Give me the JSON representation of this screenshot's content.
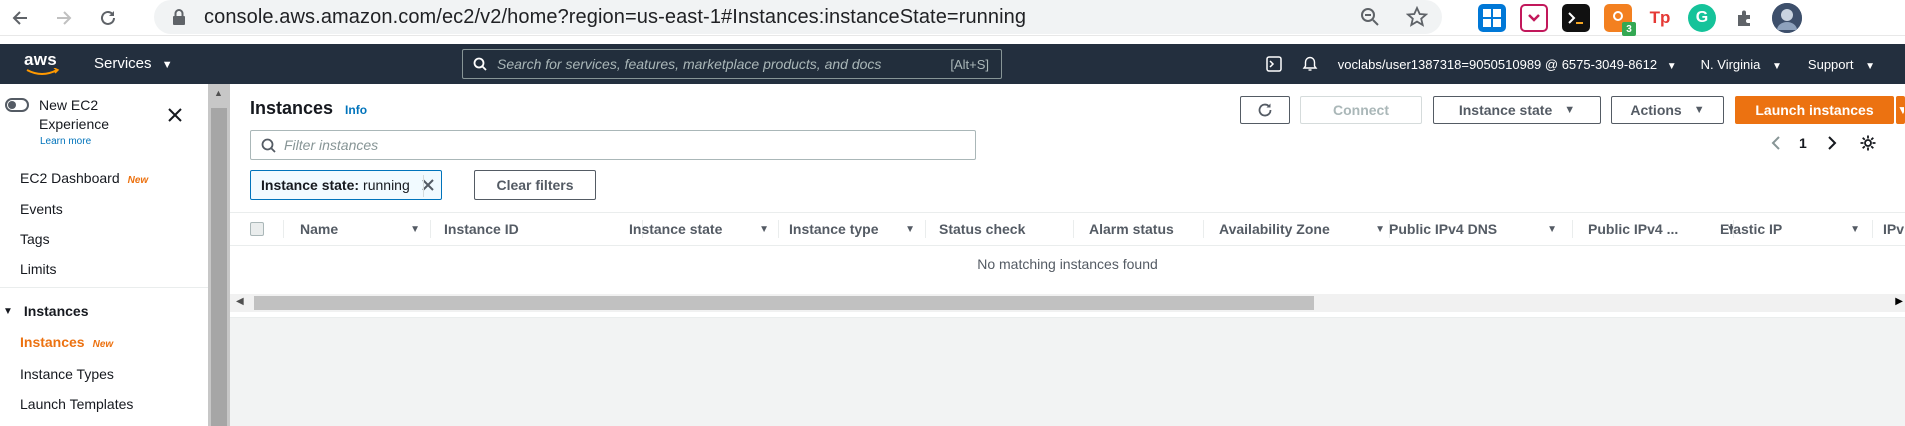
{
  "browser": {
    "url": "console.aws.amazon.com/ec2/v2/home?region=us-east-1#Instances:instanceState=running",
    "extensions": [
      {
        "name": "windows-ext-icon",
        "color": "#0078d7",
        "label": ""
      },
      {
        "name": "pocket-ext-icon",
        "color": "#e91e63",
        "label": ""
      },
      {
        "name": "terminal-ext-icon",
        "color": "#111111",
        "label": ""
      },
      {
        "name": "orange-ext-icon",
        "color": "#f38020",
        "label": "3"
      },
      {
        "name": "tp-ext-icon",
        "color": "#ffffff",
        "label": "Tp"
      },
      {
        "name": "grammarly-ext-icon",
        "color": "#15c39a",
        "label": ""
      },
      {
        "name": "puzzle-ext-icon",
        "color": "#ffffff",
        "label": ""
      },
      {
        "name": "profile-avatar-icon",
        "color": "#6b7a8f",
        "label": ""
      }
    ]
  },
  "aws_header": {
    "logo_text": "aws",
    "services_label": "Services",
    "search_placeholder": "Search for services, features, marketplace products, and docs",
    "search_shortcut": "[Alt+S]",
    "account": "voclabs/user1387318=9050510989 @ 6575-3049-8612",
    "region": "N. Virginia",
    "support": "Support"
  },
  "sidebar": {
    "new_experience_line1": "New EC2",
    "new_experience_line2": "Experience",
    "learn_more": "Learn more",
    "items": [
      {
        "label": "EC2 Dashboard",
        "badge": "New"
      },
      {
        "label": "Events",
        "badge": ""
      },
      {
        "label": "Tags",
        "badge": ""
      },
      {
        "label": "Limits",
        "badge": ""
      }
    ],
    "section_title": "Instances",
    "section_items": [
      {
        "label": "Instances",
        "badge": "New"
      },
      {
        "label": "Instance Types",
        "badge": ""
      },
      {
        "label": "Launch Templates",
        "badge": ""
      }
    ]
  },
  "main": {
    "title": "Instances",
    "info": "Info",
    "connect": "Connect",
    "instance_state": "Instance state",
    "actions": "Actions",
    "launch": "Launch instances",
    "filter_placeholder": "Filter instances",
    "page_number": "1",
    "token_key": "Instance state:",
    "token_value": "running",
    "clear_filters": "Clear filters",
    "columns": [
      "Name",
      "Instance ID",
      "Instance state",
      "Instance type",
      "Status check",
      "Alarm status",
      "Availability Zone",
      "Public IPv4 DNS",
      "Public IPv4 ...",
      "Elastic IP",
      "IPv"
    ],
    "empty_message": "No matching instances found"
  },
  "colors": {
    "aws_navy": "#232f3e",
    "aws_orange": "#ec7211",
    "link_blue": "#0073bb"
  }
}
